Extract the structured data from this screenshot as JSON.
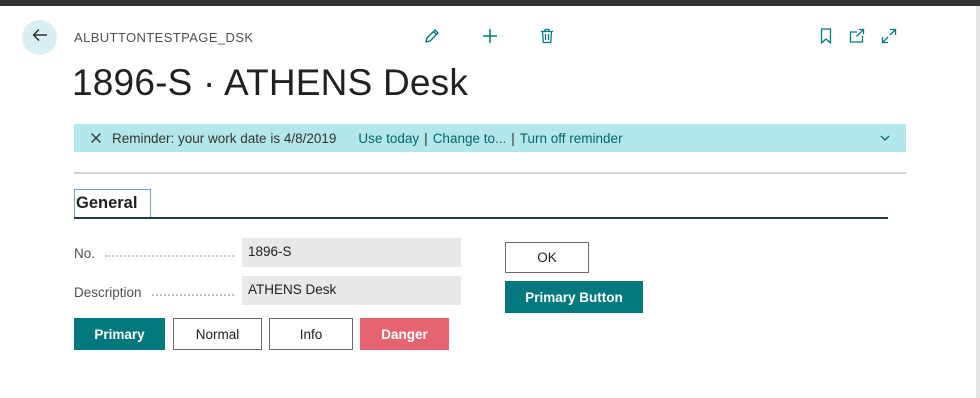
{
  "header": {
    "caption": "ALBUTTONTESTPAGE_DSK",
    "title": "1896-S · ATHENS Desk",
    "icons": {
      "back": "arrow-left-icon",
      "edit": "pencil-icon",
      "new": "plus-icon",
      "delete": "trash-icon",
      "bookmark": "bookmark-icon",
      "open_new_window": "open-in-new-window-icon",
      "expand": "expand-icon"
    }
  },
  "reminder": {
    "message": "Reminder: your work date is 4/8/2019",
    "links": [
      "Use today",
      "Change to...",
      "Turn off reminder"
    ],
    "separator": "|"
  },
  "general": {
    "tab_label": "General",
    "fields": [
      {
        "label": "No.",
        "value": "1896-S"
      },
      {
        "label": "Description",
        "value": "ATHENS Desk"
      }
    ]
  },
  "buttons": {
    "primary": "Primary",
    "normal": "Normal",
    "info": "Info",
    "danger": "Danger",
    "ok": "OK",
    "primary_button": "Primary Button"
  },
  "colors": {
    "accent": "#00787d",
    "reminder_bg": "#b3e7ec",
    "danger": "#e56470",
    "back_button_bg": "#d9f0f2"
  }
}
